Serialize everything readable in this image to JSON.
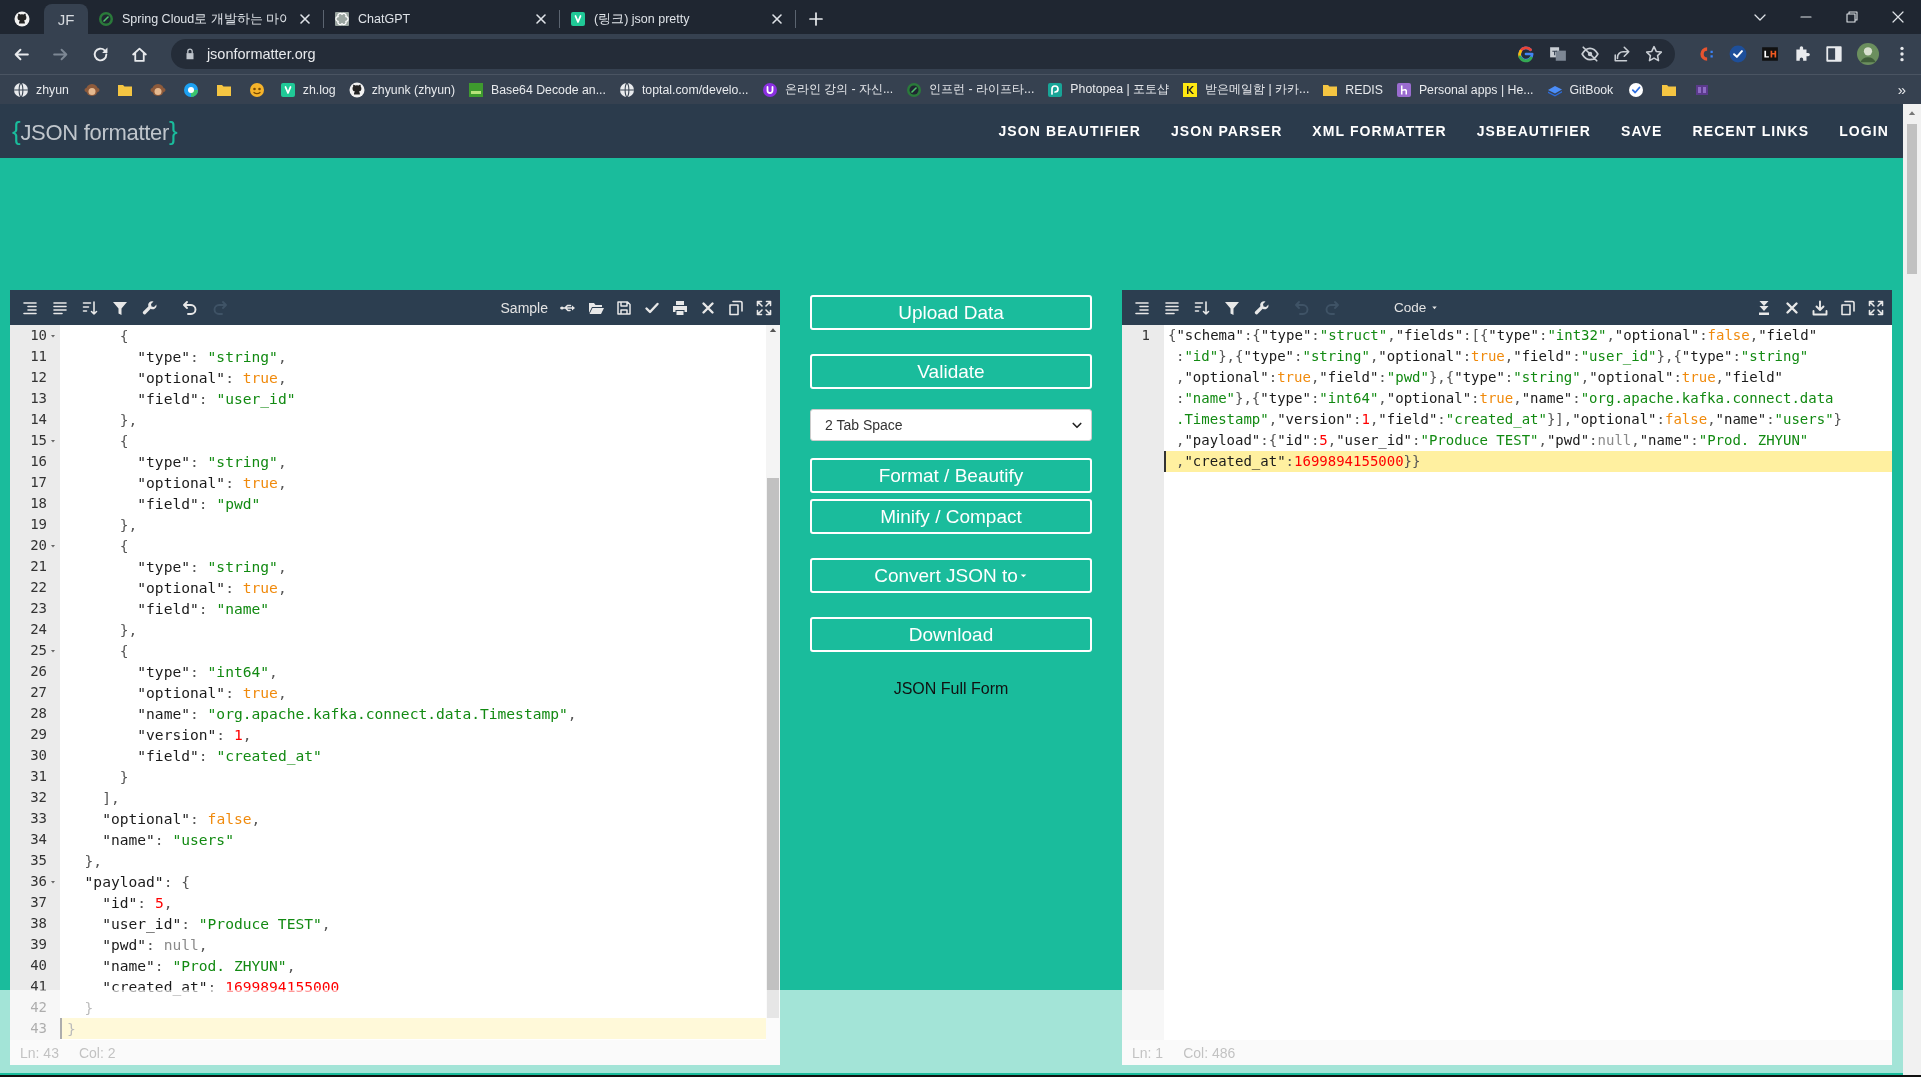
{
  "browser": {
    "tabs": [
      {
        "kind": "pinned",
        "selected": false
      },
      {
        "kind": "pinned",
        "label": "JF",
        "selected": true
      },
      {
        "kind": "normal",
        "label": "Spring Cloud로 개발하는 마이",
        "selected": false
      },
      {
        "kind": "normal",
        "label": "ChatGPT",
        "selected": false
      },
      {
        "kind": "normal",
        "label": "(링크) json pretty",
        "selected": false
      }
    ],
    "nav_buttons": [
      {
        "kind": "back",
        "disabled": false
      },
      {
        "kind": "forward",
        "disabled": true
      },
      {
        "kind": "reload",
        "disabled": false
      },
      {
        "kind": "home",
        "disabled": false
      }
    ],
    "address": "jsonformatter.org",
    "bookmarks": [
      {
        "kind": "link",
        "label": "zhyun"
      },
      {
        "kind": "icon"
      },
      {
        "kind": "icon"
      },
      {
        "kind": "icon"
      },
      {
        "kind": "icon"
      },
      {
        "kind": "icon"
      },
      {
        "kind": "icon"
      },
      {
        "kind": "link",
        "label": "zh.log"
      },
      {
        "kind": "link",
        "label": "zhyunk (zhyun)"
      },
      {
        "kind": "link",
        "label": "Base64 Decode an..."
      },
      {
        "kind": "link",
        "label": "toptal.com/develo..."
      },
      {
        "kind": "link",
        "label": "온라인 강의 - 자신..."
      },
      {
        "kind": "link",
        "label": "인프런 - 라이프타..."
      },
      {
        "kind": "link",
        "label": "Photopea | 포토샵"
      },
      {
        "kind": "link",
        "label": "받은메일함 | 카카..."
      },
      {
        "kind": "link",
        "label": "REDIS"
      },
      {
        "kind": "link",
        "label": "Personal apps | He..."
      },
      {
        "kind": "link",
        "label": "GitBook"
      },
      {
        "kind": "icon"
      },
      {
        "kind": "icon"
      },
      {
        "kind": "icon"
      }
    ],
    "bookmarks_overflow": "»"
  },
  "site": {
    "logo": {
      "open": "{",
      "name": "JSON formatter",
      "close": "}"
    },
    "nav": [
      "JSON BEAUTIFIER",
      "JSON PARSER",
      "XML FORMATTER",
      "JSBEAUTIFIER",
      "SAVE",
      "RECENT LINKS",
      "LOGIN"
    ]
  },
  "left_editor": {
    "toolbar_start": [
      {
        "kind": "format",
        "disabled": false
      },
      {
        "kind": "compact",
        "disabled": false
      },
      {
        "kind": "sort",
        "disabled": false
      },
      {
        "kind": "filter",
        "disabled": false
      },
      {
        "kind": "wrench",
        "disabled": false
      },
      {
        "kind": "undo",
        "disabled": false
      },
      {
        "kind": "redo",
        "disabled": true
      }
    ],
    "toolbar_end": [
      {
        "kind": "text",
        "label": "Sample",
        "disabled": false
      },
      {
        "kind": "usb",
        "disabled": false
      },
      {
        "kind": "folder",
        "disabled": false
      },
      {
        "kind": "save",
        "disabled": false
      },
      {
        "kind": "check",
        "disabled": false
      },
      {
        "kind": "print",
        "disabled": false
      },
      {
        "kind": "close",
        "disabled": false
      },
      {
        "kind": "copy",
        "disabled": false
      },
      {
        "kind": "expand",
        "disabled": false
      }
    ],
    "lines": [
      {
        "number": "10",
        "fold": true,
        "active": false,
        "tokens": [
          {
            "kind": "punct",
            "text": "{"
          }
        ]
      },
      {
        "number": "11",
        "fold": false,
        "active": false,
        "tokens": [
          {
            "kind": "key",
            "text": "\"type\""
          },
          {
            "kind": "punct",
            "text": ": "
          },
          {
            "kind": "string",
            "text": "\"string\""
          },
          {
            "kind": "punct",
            "text": ","
          }
        ]
      },
      {
        "number": "12",
        "fold": false,
        "active": false,
        "tokens": [
          {
            "kind": "key",
            "text": "\"optional\""
          },
          {
            "kind": "punct",
            "text": ": "
          },
          {
            "kind": "boolean",
            "text": "true"
          },
          {
            "kind": "punct",
            "text": ","
          }
        ]
      },
      {
        "number": "13",
        "fold": false,
        "active": false,
        "tokens": [
          {
            "kind": "key",
            "text": "\"field\""
          },
          {
            "kind": "punct",
            "text": ": "
          },
          {
            "kind": "string",
            "text": "\"user_id\""
          }
        ]
      },
      {
        "number": "14",
        "fold": false,
        "active": false,
        "tokens": [
          {
            "kind": "punct",
            "text": "},"
          }
        ]
      },
      {
        "number": "15",
        "fold": true,
        "active": false,
        "tokens": [
          {
            "kind": "punct",
            "text": "{"
          }
        ]
      },
      {
        "number": "16",
        "fold": false,
        "active": false,
        "tokens": [
          {
            "kind": "key",
            "text": "\"type\""
          },
          {
            "kind": "punct",
            "text": ": "
          },
          {
            "kind": "string",
            "text": "\"string\""
          },
          {
            "kind": "punct",
            "text": ","
          }
        ]
      },
      {
        "number": "17",
        "fold": false,
        "active": false,
        "tokens": [
          {
            "kind": "key",
            "text": "\"optional\""
          },
          {
            "kind": "punct",
            "text": ": "
          },
          {
            "kind": "boolean",
            "text": "true"
          },
          {
            "kind": "punct",
            "text": ","
          }
        ]
      },
      {
        "number": "18",
        "fold": false,
        "active": false,
        "tokens": [
          {
            "kind": "key",
            "text": "\"field\""
          },
          {
            "kind": "punct",
            "text": ": "
          },
          {
            "kind": "string",
            "text": "\"pwd\""
          }
        ]
      },
      {
        "number": "19",
        "fold": false,
        "active": false,
        "tokens": [
          {
            "kind": "punct",
            "text": "},"
          }
        ]
      },
      {
        "number": "20",
        "fold": true,
        "active": false,
        "tokens": [
          {
            "kind": "punct",
            "text": "{"
          }
        ]
      },
      {
        "number": "21",
        "fold": false,
        "active": false,
        "tokens": [
          {
            "kind": "key",
            "text": "\"type\""
          },
          {
            "kind": "punct",
            "text": ": "
          },
          {
            "kind": "string",
            "text": "\"string\""
          },
          {
            "kind": "punct",
            "text": ","
          }
        ]
      },
      {
        "number": "22",
        "fold": false,
        "active": false,
        "tokens": [
          {
            "kind": "key",
            "text": "\"optional\""
          },
          {
            "kind": "punct",
            "text": ": "
          },
          {
            "kind": "boolean",
            "text": "true"
          },
          {
            "kind": "punct",
            "text": ","
          }
        ]
      },
      {
        "number": "23",
        "fold": false,
        "active": false,
        "tokens": [
          {
            "kind": "key",
            "text": "\"field\""
          },
          {
            "kind": "punct",
            "text": ": "
          },
          {
            "kind": "string",
            "text": "\"name\""
          }
        ]
      },
      {
        "number": "24",
        "fold": false,
        "active": false,
        "tokens": [
          {
            "kind": "punct",
            "text": "},"
          }
        ]
      },
      {
        "number": "25",
        "fold": true,
        "active": false,
        "tokens": [
          {
            "kind": "punct",
            "text": "{"
          }
        ]
      },
      {
        "number": "26",
        "fold": false,
        "active": false,
        "tokens": [
          {
            "kind": "key",
            "text": "\"type\""
          },
          {
            "kind": "punct",
            "text": ": "
          },
          {
            "kind": "string",
            "text": "\"int64\""
          },
          {
            "kind": "punct",
            "text": ","
          }
        ]
      },
      {
        "number": "27",
        "fold": false,
        "active": false,
        "tokens": [
          {
            "kind": "key",
            "text": "\"optional\""
          },
          {
            "kind": "punct",
            "text": ": "
          },
          {
            "kind": "boolean",
            "text": "true"
          },
          {
            "kind": "punct",
            "text": ","
          }
        ]
      },
      {
        "number": "28",
        "fold": false,
        "active": false,
        "tokens": [
          {
            "kind": "key",
            "text": "\"name\""
          },
          {
            "kind": "punct",
            "text": ": "
          },
          {
            "kind": "string",
            "text": "\"org.apache.kafka.connect.data.Timestamp\""
          },
          {
            "kind": "punct",
            "text": ","
          }
        ]
      },
      {
        "number": "29",
        "fold": false,
        "active": false,
        "tokens": [
          {
            "kind": "key",
            "text": "\"version\""
          },
          {
            "kind": "punct",
            "text": ": "
          },
          {
            "kind": "number",
            "text": "1"
          },
          {
            "kind": "punct",
            "text": ","
          }
        ]
      },
      {
        "number": "30",
        "fold": false,
        "active": false,
        "tokens": [
          {
            "kind": "key",
            "text": "\"field\""
          },
          {
            "kind": "punct",
            "text": ": "
          },
          {
            "kind": "string",
            "text": "\"created_at\""
          }
        ]
      },
      {
        "number": "31",
        "fold": false,
        "active": false,
        "tokens": [
          {
            "kind": "punct",
            "text": "}"
          }
        ]
      },
      {
        "number": "32",
        "fold": false,
        "active": false,
        "tokens": [
          {
            "kind": "punct",
            "text": "],"
          }
        ]
      },
      {
        "number": "33",
        "fold": false,
        "active": false,
        "tokens": [
          {
            "kind": "key",
            "text": "\"optional\""
          },
          {
            "kind": "punct",
            "text": ": "
          },
          {
            "kind": "boolean",
            "text": "false"
          },
          {
            "kind": "punct",
            "text": ","
          }
        ]
      },
      {
        "number": "34",
        "fold": false,
        "active": false,
        "tokens": [
          {
            "kind": "key",
            "text": "\"name\""
          },
          {
            "kind": "punct",
            "text": ": "
          },
          {
            "kind": "string",
            "text": "\"users\""
          }
        ]
      },
      {
        "number": "35",
        "fold": false,
        "active": false,
        "tokens": [
          {
            "kind": "punct",
            "text": "},"
          }
        ]
      },
      {
        "number": "36",
        "fold": true,
        "active": false,
        "tokens": [
          {
            "kind": "key",
            "text": "\"payload\""
          },
          {
            "kind": "punct",
            "text": ": {"
          }
        ]
      },
      {
        "number": "37",
        "fold": false,
        "active": false,
        "tokens": [
          {
            "kind": "key",
            "text": "\"id\""
          },
          {
            "kind": "punct",
            "text": ": "
          },
          {
            "kind": "number",
            "text": "5"
          },
          {
            "kind": "punct",
            "text": ","
          }
        ]
      },
      {
        "number": "38",
        "fold": false,
        "active": false,
        "tokens": [
          {
            "kind": "key",
            "text": "\"user_id\""
          },
          {
            "kind": "punct",
            "text": ": "
          },
          {
            "kind": "string",
            "text": "\"Produce TEST\""
          },
          {
            "kind": "punct",
            "text": ","
          }
        ]
      },
      {
        "number": "39",
        "fold": false,
        "active": false,
        "tokens": [
          {
            "kind": "key",
            "text": "\"pwd\""
          },
          {
            "kind": "punct",
            "text": ": "
          },
          {
            "kind": "null",
            "text": "null"
          },
          {
            "kind": "punct",
            "text": ","
          }
        ]
      },
      {
        "number": "40",
        "fold": false,
        "active": false,
        "tokens": [
          {
            "kind": "key",
            "text": "\"name\""
          },
          {
            "kind": "punct",
            "text": ": "
          },
          {
            "kind": "string",
            "text": "\"Prod. ZHYUN\""
          },
          {
            "kind": "punct",
            "text": ","
          }
        ]
      },
      {
        "number": "41",
        "fold": false,
        "active": false,
        "tokens": [
          {
            "kind": "key",
            "text": "\"created_at\""
          },
          {
            "kind": "punct",
            "text": ": "
          },
          {
            "kind": "number",
            "text": "1699894155000"
          }
        ]
      },
      {
        "number": "42",
        "fold": false,
        "active": false,
        "tokens": [
          {
            "kind": "punct",
            "text": "}"
          }
        ]
      },
      {
        "number": "43",
        "fold": false,
        "active": true,
        "tokens": [
          {
            "kind": "punct",
            "text": "}"
          }
        ]
      }
    ],
    "status": {
      "line": "Ln: 43",
      "column": "Col: 2"
    }
  },
  "actions": [
    {
      "kind": "button",
      "label": "Upload Data"
    },
    {
      "kind": "button",
      "label": "Validate"
    },
    {
      "kind": "select",
      "value": "2 Tab Space"
    },
    {
      "kind": "button",
      "label": "Format / Beautify"
    },
    {
      "kind": "button",
      "label": "Minify / Compact"
    },
    {
      "kind": "dropdown",
      "label": "Convert JSON to"
    },
    {
      "kind": "button",
      "label": "Download"
    },
    {
      "kind": "link",
      "label": "JSON Full Form"
    }
  ],
  "right_editor": {
    "toolbar_start": [
      {
        "kind": "format",
        "disabled": false
      },
      {
        "kind": "compact",
        "disabled": false
      },
      {
        "kind": "sort",
        "disabled": false
      },
      {
        "kind": "filter",
        "disabled": false
      },
      {
        "kind": "wrench",
        "disabled": false
      },
      {
        "kind": "undo",
        "disabled": true
      },
      {
        "kind": "redo",
        "disabled": true
      },
      {
        "kind": "menu",
        "label": "Code",
        "disabled": false
      }
    ],
    "toolbar_end": [
      {
        "kind": "collapse",
        "disabled": false
      },
      {
        "kind": "close",
        "disabled": false
      },
      {
        "kind": "download",
        "disabled": false
      },
      {
        "kind": "copy",
        "disabled": false
      },
      {
        "kind": "expand",
        "disabled": false
      }
    ],
    "lines": [
      {
        "number": "1",
        "rows": [
          {
            "active": false,
            "tokens": [
              {
                "kind": "punct",
                "text": "{"
              },
              {
                "kind": "key",
                "text": "\"schema\""
              },
              {
                "kind": "punct",
                "text": ":{"
              },
              {
                "kind": "key",
                "text": "\"type\""
              },
              {
                "kind": "punct",
                "text": ":"
              },
              {
                "kind": "string",
                "text": "\"struct\""
              },
              {
                "kind": "punct",
                "text": ","
              },
              {
                "kind": "key",
                "text": "\"fields\""
              },
              {
                "kind": "punct",
                "text": ":[{"
              },
              {
                "kind": "key",
                "text": "\"type\""
              },
              {
                "kind": "punct",
                "text": ":"
              },
              {
                "kind": "string",
                "text": "\"int32\""
              },
              {
                "kind": "punct",
                "text": ","
              },
              {
                "kind": "key",
                "text": "\"optional\""
              },
              {
                "kind": "punct",
                "text": ":"
              },
              {
                "kind": "boolean",
                "text": "false"
              },
              {
                "kind": "punct",
                "text": ","
              },
              {
                "kind": "key",
                "text": "\"field\""
              }
            ]
          },
          {
            "active": false,
            "tokens": [
              {
                "kind": "punct",
                "text": ":"
              },
              {
                "kind": "string",
                "text": "\"id\""
              },
              {
                "kind": "punct",
                "text": "},{"
              },
              {
                "kind": "key",
                "text": "\"type\""
              },
              {
                "kind": "punct",
                "text": ":"
              },
              {
                "kind": "string",
                "text": "\"string\""
              },
              {
                "kind": "punct",
                "text": ","
              },
              {
                "kind": "key",
                "text": "\"optional\""
              },
              {
                "kind": "punct",
                "text": ":"
              },
              {
                "kind": "boolean",
                "text": "true"
              },
              {
                "kind": "punct",
                "text": ","
              },
              {
                "kind": "key",
                "text": "\"field\""
              },
              {
                "kind": "punct",
                "text": ":"
              },
              {
                "kind": "string",
                "text": "\"user_id\""
              },
              {
                "kind": "punct",
                "text": "},{"
              },
              {
                "kind": "key",
                "text": "\"type\""
              },
              {
                "kind": "punct",
                "text": ":"
              },
              {
                "kind": "string",
                "text": "\"string\""
              }
            ]
          },
          {
            "active": false,
            "tokens": [
              {
                "kind": "punct",
                "text": ","
              },
              {
                "kind": "key",
                "text": "\"optional\""
              },
              {
                "kind": "punct",
                "text": ":"
              },
              {
                "kind": "boolean",
                "text": "true"
              },
              {
                "kind": "punct",
                "text": ","
              },
              {
                "kind": "key",
                "text": "\"field\""
              },
              {
                "kind": "punct",
                "text": ":"
              },
              {
                "kind": "string",
                "text": "\"pwd\""
              },
              {
                "kind": "punct",
                "text": "},{"
              },
              {
                "kind": "key",
                "text": "\"type\""
              },
              {
                "kind": "punct",
                "text": ":"
              },
              {
                "kind": "string",
                "text": "\"string\""
              },
              {
                "kind": "punct",
                "text": ","
              },
              {
                "kind": "key",
                "text": "\"optional\""
              },
              {
                "kind": "punct",
                "text": ":"
              },
              {
                "kind": "boolean",
                "text": "true"
              },
              {
                "kind": "punct",
                "text": ","
              },
              {
                "kind": "key",
                "text": "\"field\""
              }
            ]
          },
          {
            "active": false,
            "tokens": [
              {
                "kind": "punct",
                "text": ":"
              },
              {
                "kind": "string",
                "text": "\"name\""
              },
              {
                "kind": "punct",
                "text": "},{"
              },
              {
                "kind": "key",
                "text": "\"type\""
              },
              {
                "kind": "punct",
                "text": ":"
              },
              {
                "kind": "string",
                "text": "\"int64\""
              },
              {
                "kind": "punct",
                "text": ","
              },
              {
                "kind": "key",
                "text": "\"optional\""
              },
              {
                "kind": "punct",
                "text": ":"
              },
              {
                "kind": "boolean",
                "text": "true"
              },
              {
                "kind": "punct",
                "text": ","
              },
              {
                "kind": "key",
                "text": "\"name\""
              },
              {
                "kind": "punct",
                "text": ":"
              },
              {
                "kind": "string",
                "text": "\"org.apache.kafka.connect.data"
              }
            ]
          },
          {
            "active": false,
            "tokens": [
              {
                "kind": "string",
                "text": ".Timestamp\""
              },
              {
                "kind": "punct",
                "text": ","
              },
              {
                "kind": "key",
                "text": "\"version\""
              },
              {
                "kind": "punct",
                "text": ":"
              },
              {
                "kind": "number",
                "text": "1"
              },
              {
                "kind": "punct",
                "text": ","
              },
              {
                "kind": "key",
                "text": "\"field\""
              },
              {
                "kind": "punct",
                "text": ":"
              },
              {
                "kind": "string",
                "text": "\"created_at\""
              },
              {
                "kind": "punct",
                "text": "}],"
              },
              {
                "kind": "key",
                "text": "\"optional\""
              },
              {
                "kind": "punct",
                "text": ":"
              },
              {
                "kind": "boolean",
                "text": "false"
              },
              {
                "kind": "punct",
                "text": ","
              },
              {
                "kind": "key",
                "text": "\"name\""
              },
              {
                "kind": "punct",
                "text": ":"
              },
              {
                "kind": "string",
                "text": "\"users\""
              },
              {
                "kind": "punct",
                "text": "}"
              }
            ]
          },
          {
            "active": false,
            "tokens": [
              {
                "kind": "punct",
                "text": ","
              },
              {
                "kind": "key",
                "text": "\"payload\""
              },
              {
                "kind": "punct",
                "text": ":{"
              },
              {
                "kind": "key",
                "text": "\"id\""
              },
              {
                "kind": "punct",
                "text": ":"
              },
              {
                "kind": "number",
                "text": "5"
              },
              {
                "kind": "punct",
                "text": ","
              },
              {
                "kind": "key",
                "text": "\"user_id\""
              },
              {
                "kind": "punct",
                "text": ":"
              },
              {
                "kind": "string",
                "text": "\"Produce TEST\""
              },
              {
                "kind": "punct",
                "text": ","
              },
              {
                "kind": "key",
                "text": "\"pwd\""
              },
              {
                "kind": "punct",
                "text": ":"
              },
              {
                "kind": "null",
                "text": "null"
              },
              {
                "kind": "punct",
                "text": ","
              },
              {
                "kind": "key",
                "text": "\"name\""
              },
              {
                "kind": "punct",
                "text": ":"
              },
              {
                "kind": "string",
                "text": "\"Prod. ZHYUN\""
              }
            ]
          },
          {
            "active": true,
            "tokens": [
              {
                "kind": "punct",
                "text": ","
              },
              {
                "kind": "key",
                "text": "\"created_at\""
              },
              {
                "kind": "punct",
                "text": ":"
              },
              {
                "kind": "number",
                "text": "1699894155000"
              },
              {
                "kind": "punct",
                "text": "}}"
              }
            ]
          }
        ]
      }
    ],
    "status": {
      "line": "Ln: 1",
      "column": "Col: 486"
    }
  }
}
